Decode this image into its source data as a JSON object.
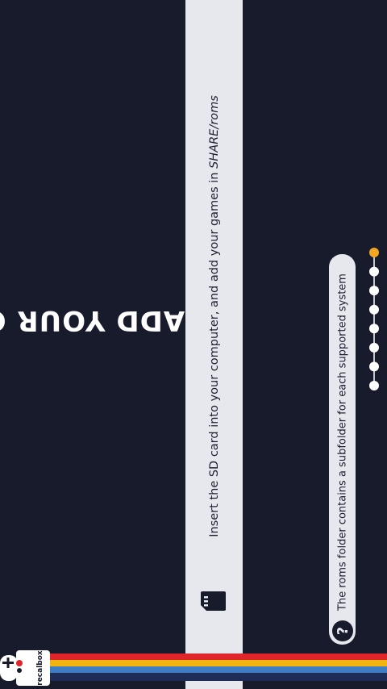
{
  "screen": {
    "title": "ADD YOUR GAMES",
    "instruction_prefix": "Insert the SD card into your computer, and add your games in ",
    "instruction_path": "SHARE/roms",
    "tip": "The roms folder contains a subfolder for each supported system",
    "pagination": {
      "total": 8,
      "active_index": 0,
      "active_color": "#f5a623",
      "inactive_color": "#ffffff"
    }
  },
  "logo": {
    "text": "recalbox"
  },
  "colors": {
    "background": "#171b2b",
    "panel": "#e6e8ee",
    "stripe_red": "#e0262b",
    "stripe_yellow": "#f2b50f",
    "stripe_blue": "#3e7cc4",
    "stripe_navy": "#1e2d58"
  },
  "icons": {
    "sd": "sd-card-icon",
    "help": "question-circle-icon"
  }
}
